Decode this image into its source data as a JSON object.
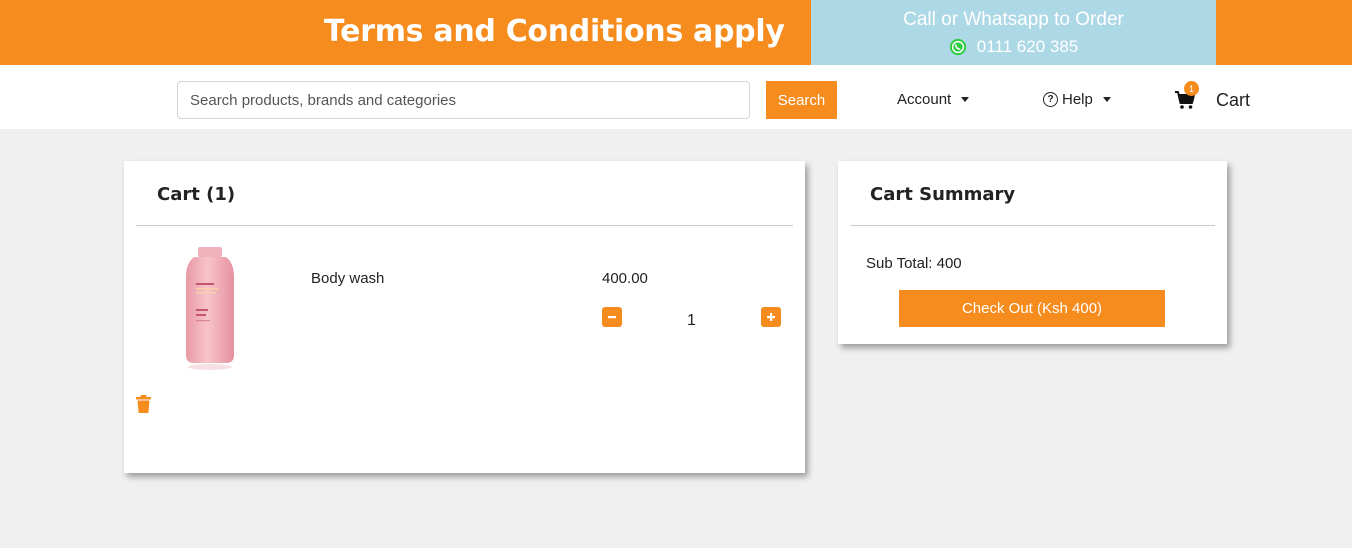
{
  "banner": {
    "title": "Terms and Conditions apply",
    "call_text": "Call or Whatsapp to Order",
    "phone": "0111 620 385",
    "phone_icon": "whatsapp-icon"
  },
  "navbar": {
    "search_placeholder": "Search products, brands and categories",
    "search_label": "Search",
    "account_label": "Account",
    "help_label": "Help",
    "cart_label": "Cart",
    "cart_count": "1"
  },
  "cart": {
    "title": "Cart (1)",
    "items": [
      {
        "name": "Body wash",
        "price": "400.00",
        "quantity": "1"
      }
    ]
  },
  "summary": {
    "title": "Cart Summary",
    "subtotal": "Sub Total: 400",
    "checkout_label": "Check Out (Ksh 400)"
  },
  "colors": {
    "accent": "#f68b1e",
    "call_box": "#add8e6",
    "background": "#f0f0f0"
  }
}
